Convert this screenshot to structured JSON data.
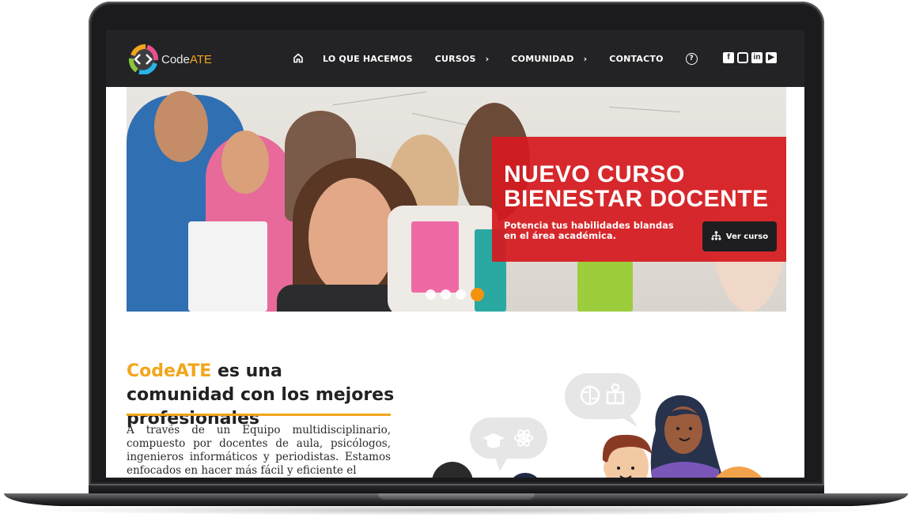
{
  "brand": {
    "name_prefix": "Code",
    "name_accent": "ATE"
  },
  "nav": {
    "items": [
      {
        "label": "LO QUE HACEMOS"
      },
      {
        "label": "CURSOS"
      },
      {
        "label": "COMUNIDAD"
      },
      {
        "label": "CONTACTO"
      }
    ]
  },
  "social": {
    "icons": [
      "facebook-icon",
      "instagram-icon",
      "linkedin-icon",
      "youtube-icon"
    ]
  },
  "hero": {
    "title": "NUEVO CURSO\nBIENESTAR DOCENTE",
    "subtitle": "Potencia tus habilidades blandas en el área académica.",
    "cta_label": "Ver curso",
    "slides_total": 4,
    "active_slide": 4
  },
  "about": {
    "heading_brand": "CodeATE",
    "heading_rest": " es una comunidad con los mejores profesionales",
    "paragraph": "A través de un Equipo multidisciplinario, compuesto por docentes de aula, psicólogos, ingenieros informáticos y periodistas. Estamos enfocados en hacer más fácil y eficiente el"
  },
  "colors": {
    "accent": "#f2a61c",
    "navbar": "#232326",
    "banner": "#d51a1f",
    "active_dot": "#f2920f"
  }
}
